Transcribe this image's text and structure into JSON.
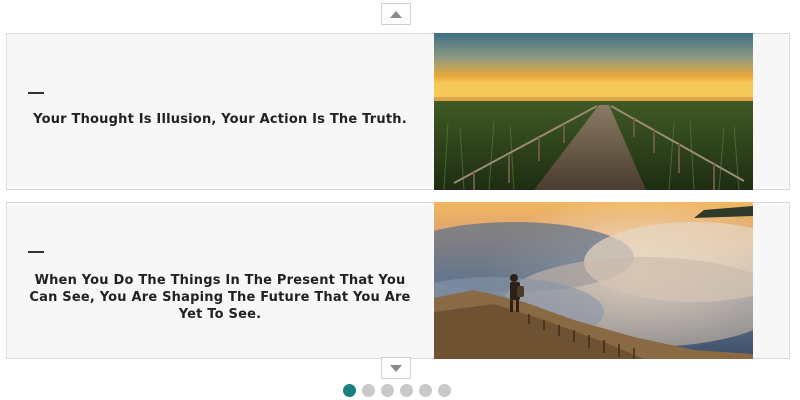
{
  "nav": {
    "up_icon": "chevron-up-icon",
    "down_icon": "chevron-down-icon"
  },
  "slides": [
    {
      "dash": "—",
      "quote": "Your Thought Is Illusion, Your Action Is The Truth.",
      "image": "boardwalk-sunset-photo"
    },
    {
      "dash": "—",
      "quote": "When You Do The Things In The Present That You Can See, You Are Shaping The Future That You Are Yet To See.",
      "image": "hiker-above-clouds-photo"
    }
  ],
  "pagination": {
    "count": 6,
    "active_index": 0,
    "active_color": "#1a7f80",
    "inactive_color": "#c9c9c9"
  }
}
